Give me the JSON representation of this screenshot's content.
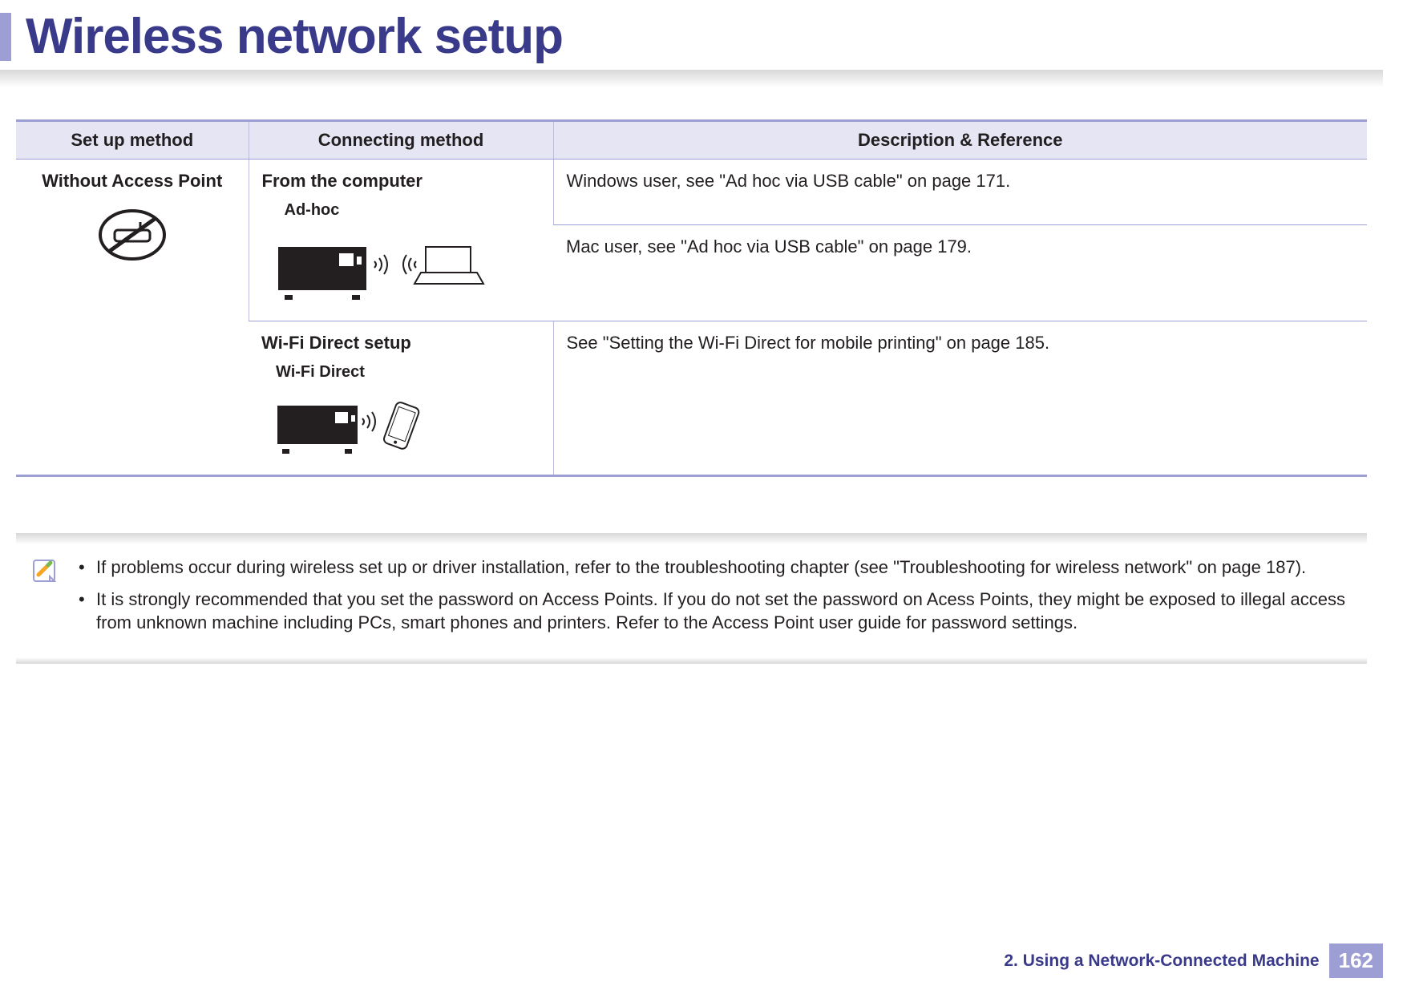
{
  "title": "Wireless network setup",
  "table": {
    "headers": [
      "Set up method",
      "Connecting method",
      "Description & Reference"
    ],
    "setupMethod": "Without Access Point",
    "rows": [
      {
        "connTitle": "From the computer",
        "illusLabel": "Ad-hoc",
        "descTop": "Windows user, see \"Ad hoc via USB cable\" on page 171.",
        "descBot": "Mac user, see \"Ad hoc via USB cable\" on page 179."
      },
      {
        "connTitle": "Wi-Fi Direct setup",
        "illusLabel": "Wi-Fi Direct",
        "desc": "See \"Setting the Wi-Fi Direct for mobile printing\" on page 185."
      }
    ]
  },
  "notes": [
    "If problems occur during wireless set up or driver installation, refer to the troubleshooting chapter (see \"Troubleshooting for wireless network\" on page 187).",
    "It is strongly recommended that you set the password on Access Points. If you do not set the password on Acess Points, they might be exposed to illegal access from unknown machine including PCs, smart phones and printers. Refer to the Access Point user guide for password settings."
  ],
  "footer": {
    "chapter": "2.  Using a Network-Connected Machine",
    "page": "162"
  }
}
